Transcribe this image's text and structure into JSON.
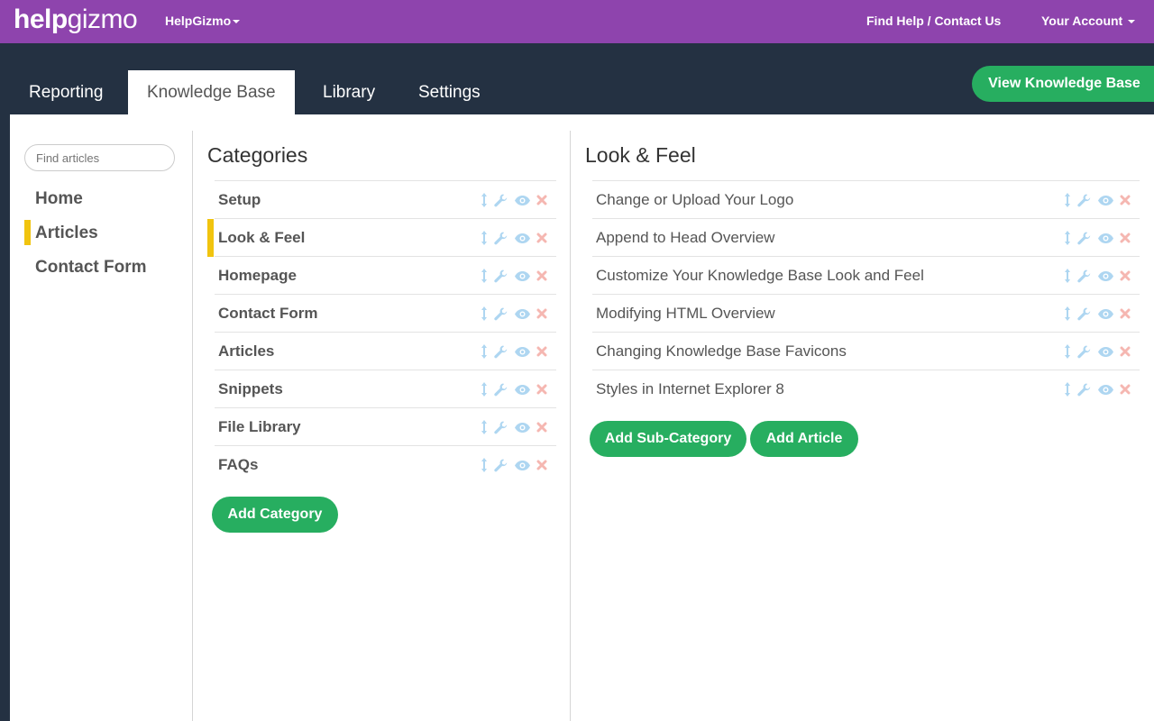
{
  "header": {
    "logo_bold": "help",
    "logo_light": "gizmo",
    "org_menu": "HelpGizmo",
    "find_help": "Find Help / Contact Us",
    "account_menu": "Your Account"
  },
  "tabs": [
    {
      "label": "Reporting"
    },
    {
      "label": "Knowledge Base",
      "active": true
    },
    {
      "label": "Library"
    },
    {
      "label": "Settings"
    }
  ],
  "view_kb_button": "View Knowledge Base",
  "sidebar": {
    "search_placeholder": "Find articles",
    "items": [
      {
        "label": "Home"
      },
      {
        "label": "Articles",
        "active": true
      },
      {
        "label": "Contact Form"
      }
    ]
  },
  "categories": {
    "title": "Categories",
    "items": [
      {
        "label": "Setup"
      },
      {
        "label": "Look & Feel",
        "active": true
      },
      {
        "label": "Homepage"
      },
      {
        "label": "Contact Form"
      },
      {
        "label": "Articles"
      },
      {
        "label": "Snippets"
      },
      {
        "label": "File Library"
      },
      {
        "label": "FAQs"
      }
    ],
    "add_button": "Add Category"
  },
  "articles": {
    "title": "Look & Feel",
    "items": [
      {
        "label": "Change or Upload Your Logo"
      },
      {
        "label": "Append to Head Overview"
      },
      {
        "label": "Customize Your Knowledge Base Look and Feel"
      },
      {
        "label": "Modifying HTML Overview"
      },
      {
        "label": "Changing Knowledge Base Favicons"
      },
      {
        "label": "Styles in Internet Explorer 8"
      }
    ],
    "add_subcategory_button": "Add Sub-Category",
    "add_article_button": "Add Article"
  },
  "row_icons": [
    "reorder-icon",
    "wrench-icon",
    "eye-icon",
    "delete-icon"
  ],
  "colors": {
    "topbar": "#8e44ad",
    "nav_background": "#243142",
    "accent_green": "#27ae60",
    "active_marker": "#f1c40f",
    "icon_blue": "#aed6f1",
    "icon_red": "#f5b7b1"
  }
}
